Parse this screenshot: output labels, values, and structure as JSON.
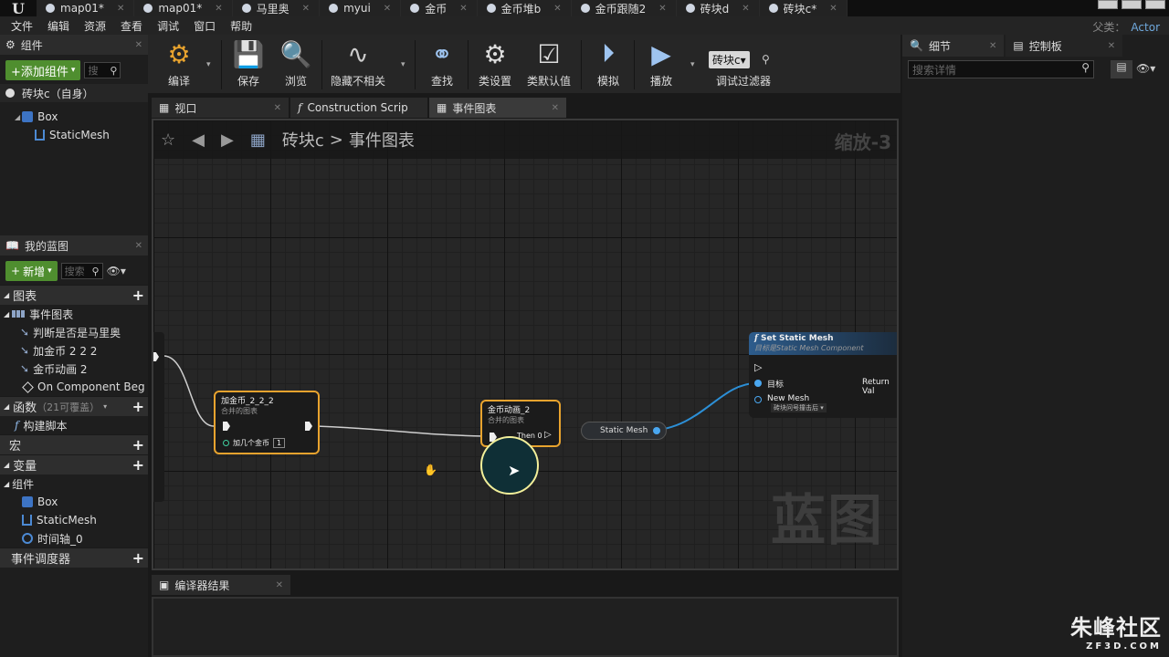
{
  "doc_tabs": [
    "map01*",
    "map01*",
    "马里奥",
    "myui",
    "金币",
    "金币堆b",
    "金币跟随2",
    "砖块d",
    "砖块c*"
  ],
  "menu": [
    "文件",
    "编辑",
    "资源",
    "查看",
    "调试",
    "窗口",
    "帮助"
  ],
  "parent_class": {
    "label": "父类：",
    "value": "Actor"
  },
  "components_panel": {
    "title": "组件",
    "add_button": "+添加组件",
    "search_placeholder": "搜",
    "self_item": "砖块c（自身）",
    "tree": [
      "Box",
      "StaticMesh"
    ]
  },
  "my_blueprint": {
    "title": "我的蓝图",
    "new_button": "新增",
    "search_placeholder": "搜索",
    "graphs_section": "图表",
    "event_graph": "事件图表",
    "event_items": [
      "判断是否是马里奥",
      "加金币 2 2 2",
      "金币动画 2",
      "On Component Beg"
    ],
    "functions_section": "函数",
    "functions_count": "（21可覆盖）",
    "construction_script": "构建脚本",
    "macros_section": "宏",
    "variables_section": "变量",
    "components_group": "组件",
    "component_vars": [
      "Box",
      "StaticMesh",
      "时间轴_0"
    ],
    "dispatchers_section": "事件调度器"
  },
  "toolbar": {
    "compile": "编译",
    "save": "保存",
    "browse": "浏览",
    "hide_unrelated": "隐藏不相关",
    "find": "查找",
    "class_settings": "类设置",
    "class_defaults": "类默认值",
    "simulate": "模拟",
    "play": "播放",
    "debug_object": "砖块c▾",
    "debug_filter": "调试过滤器"
  },
  "editor_tabs": [
    "视口",
    "Construction Scrip",
    "事件图表"
  ],
  "graph": {
    "breadcrumb_root": "砖块c",
    "breadcrumb_sep": ">",
    "breadcrumb_current": "事件图表",
    "zoom": "缩放-3",
    "watermark": "蓝图",
    "node1": {
      "title": "加金币_2_2_2",
      "subtitle": "合并的图表",
      "param_label": "加几个金币",
      "param_value": "1"
    },
    "node2": {
      "title": "金币动画_2",
      "subtitle": "合并的图表",
      "then_label": "Then 0"
    },
    "static_mesh_node": "Static Mesh",
    "set_node": {
      "title": "Set Static Mesh",
      "subtitle": "目标是Static Mesh Component",
      "target": "目标",
      "return": "Return Val",
      "new_mesh": "New Mesh",
      "mesh_value": "砖块问号撞击后"
    }
  },
  "compiler_results": "编译器结果",
  "details_panel": {
    "tab": "细节",
    "search_placeholder": "搜索详情"
  },
  "control_panel": {
    "tab": "控制板"
  },
  "brand": {
    "name": "朱峰社区",
    "url": "ZF3D.COM"
  },
  "colors": {
    "accent_green": "#4f8e2f",
    "selection_orange": "#e8a32e",
    "pin_blue": "#4aa7f0",
    "wire_blue": "#2c8fd6"
  }
}
